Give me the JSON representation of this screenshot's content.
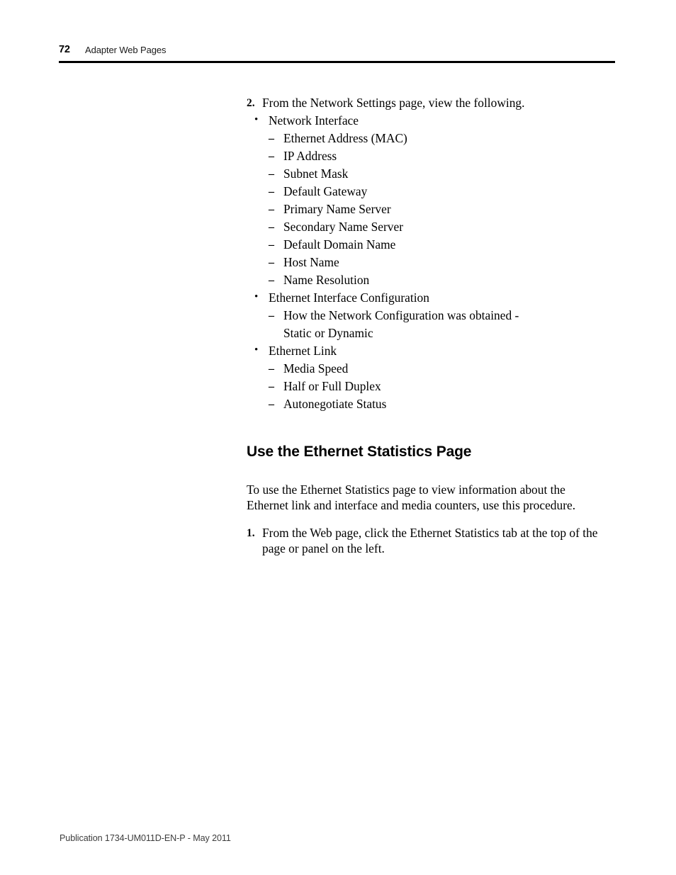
{
  "header": {
    "folio": "72",
    "chapter_title": "Adapter Web Pages"
  },
  "footer": {
    "publication": "Publication 1734-UM011D-EN-P - May 2011"
  },
  "content": {
    "step_2": {
      "marker": "2.",
      "text": "From the Network Settings page, view the following."
    },
    "groups": [
      {
        "marker": "•",
        "label": "Network Interface",
        "items": [
          {
            "marker": "–",
            "text": "Ethernet Address (MAC)"
          },
          {
            "marker": "–",
            "text": "IP Address"
          },
          {
            "marker": "–",
            "text": "Subnet Mask"
          },
          {
            "marker": "–",
            "text": "Default Gateway"
          },
          {
            "marker": "–",
            "text": "Primary Name Server"
          },
          {
            "marker": "–",
            "text": "Secondary Name Server"
          },
          {
            "marker": "–",
            "text": "Default Domain Name"
          },
          {
            "marker": "–",
            "text": "Host Name"
          },
          {
            "marker": "–",
            "text": "Name Resolution"
          }
        ]
      },
      {
        "marker": "•",
        "label": "Ethernet Interface Configuration",
        "items": [
          {
            "marker": "–",
            "text": "How the Network Configuration was obtained - Static or Dynamic"
          }
        ]
      },
      {
        "marker": "•",
        "label": "Ethernet Link",
        "items": [
          {
            "marker": "–",
            "text": "Media Speed"
          },
          {
            "marker": "–",
            "text": "Half or Full Duplex"
          },
          {
            "marker": "–",
            "text": "Autonegotiate Status"
          }
        ]
      }
    ],
    "section": {
      "heading": "Use the Ethernet Statistics Page",
      "intro": "To use the Ethernet Statistics page to view information about the Ethernet link and interface and media counters, use this procedure.",
      "step_1": {
        "marker": "1.",
        "text": "From the Web page, click the Ethernet Statistics tab at the top of the page or panel on the left."
      }
    }
  }
}
